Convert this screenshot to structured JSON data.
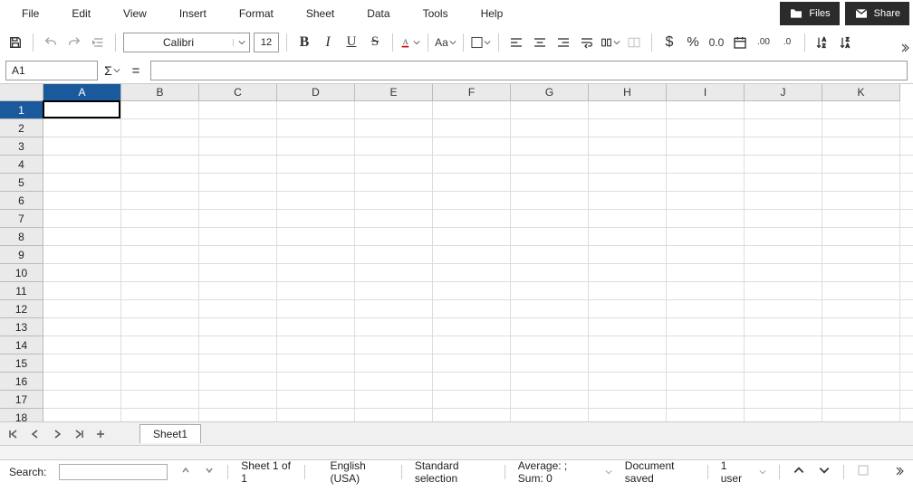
{
  "menu": {
    "items": [
      "File",
      "Edit",
      "View",
      "Insert",
      "Format",
      "Sheet",
      "Data",
      "Tools",
      "Help"
    ]
  },
  "buttons": {
    "files": "Files",
    "share": "Share"
  },
  "font": {
    "name": "Calibri",
    "size": "12"
  },
  "formula": {
    "cellref": "A1",
    "value": ""
  },
  "columns": [
    "A",
    "B",
    "C",
    "D",
    "E",
    "F",
    "G",
    "H",
    "I",
    "J",
    "K"
  ],
  "rows": [
    "1",
    "2",
    "3",
    "4",
    "5",
    "6",
    "7",
    "8",
    "9",
    "10",
    "11",
    "12",
    "13",
    "14",
    "15",
    "16",
    "17",
    "18"
  ],
  "active": {
    "col": 0,
    "row": 0
  },
  "sheet": {
    "tab": "Sheet1"
  },
  "status": {
    "search_label": "Search:",
    "search_value": "",
    "sheet_info": "Sheet 1 of 1",
    "language": "English (USA)",
    "selection": "Standard selection",
    "aggregate": "Average: ; Sum: 0",
    "save": "Document saved",
    "users": "1 user"
  }
}
